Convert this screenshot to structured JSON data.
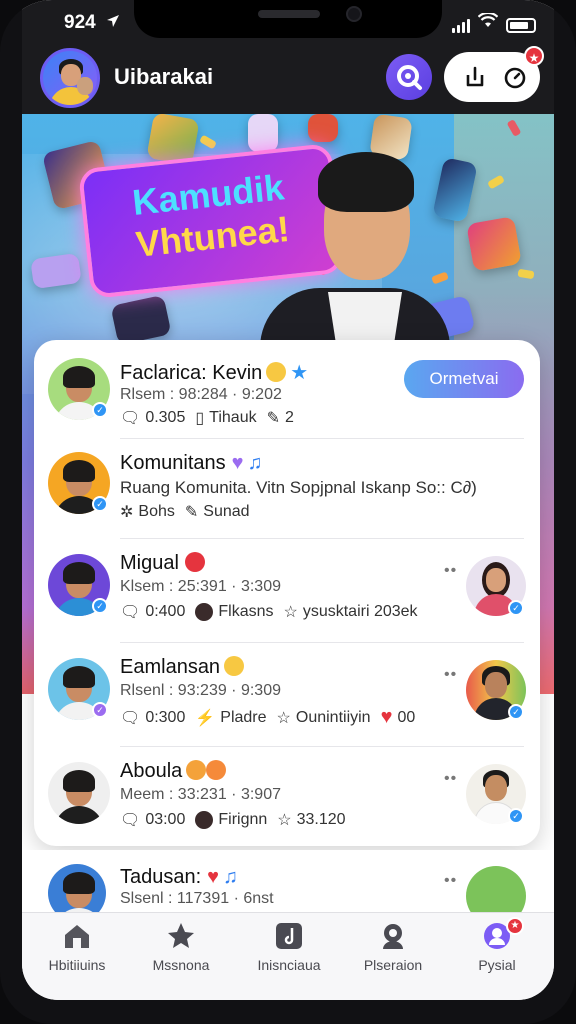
{
  "status_bar": {
    "time": "924"
  },
  "header": {
    "title": "Uibarakai",
    "notification_badge": "★"
  },
  "banner": {
    "headline_line1": "Kamudik",
    "headline_line2": "Vhtunea!"
  },
  "feed": {
    "follow_label": "Ormetvai",
    "items": [
      {
        "name": "Faclarica: Kevin",
        "meta": "Rlsem : 98:284 · 9:202",
        "stat1": "0.305",
        "stat2": "Tihauk",
        "stat3": "2"
      },
      {
        "name": "Komunitans",
        "meta": "Ruang Komunita. Vitn Sopjpnal Iskanp So:: C∂)",
        "stat1": "Bohs",
        "stat2": "Sunad"
      },
      {
        "name": "Migual",
        "meta": "Klsem : 25:391 · 3:309",
        "stat1": "0:400",
        "stat2": "Flkasns",
        "stat3": "ysusktairi 203ek"
      },
      {
        "name": "Eamlansan",
        "meta": "Rlsenl : 93:239 · 9:309",
        "stat1": "0:300",
        "stat2": "Pladre",
        "stat3": "Ounintiiyin",
        "stat4": "00"
      },
      {
        "name": "Aboula",
        "meta": "Meem : 33:231 · 3:907",
        "stat1": "03:00",
        "stat2": "Firignn",
        "stat3": "33.120"
      }
    ],
    "peek": {
      "name": "Tadusan:",
      "meta": "Slsenl : 117391 · 6nst"
    }
  },
  "bottom_nav": [
    {
      "label": "Hbitiiuins",
      "icon": "home-icon"
    },
    {
      "label": "Mssnona",
      "icon": "star-icon"
    },
    {
      "label": "Inisnciaua",
      "icon": "music-icon"
    },
    {
      "label": "Plseraion",
      "icon": "profile-icon"
    },
    {
      "label": "Pysial",
      "icon": "user-circle-icon"
    }
  ]
}
